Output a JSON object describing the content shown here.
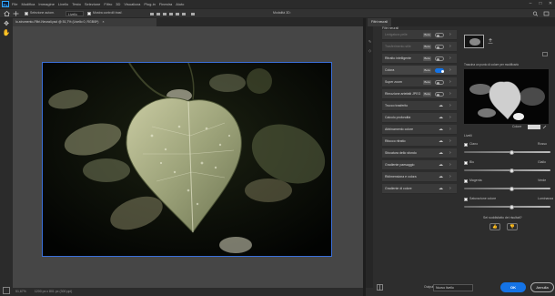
{
  "menubar": {
    "logo": "Ps",
    "items": [
      "File",
      "Modifica",
      "Immagine",
      "Livello",
      "Testo",
      "Selezione",
      "Filtro",
      "3D",
      "Visualizza",
      "Plug-in",
      "Finestra",
      "Aiuto"
    ]
  },
  "window_controls": {
    "minimize": "–",
    "maximize": "□",
    "close": "✕"
  },
  "options_bar": {
    "home_icon": "home-icon",
    "tool_icon": "move-tool-icon",
    "auto_select_label": "Selezione autom.",
    "layer_select": "Livello",
    "show_transform_label": "Mostra controlli trasf.",
    "mode_3d_label": "Modalità 3D:"
  },
  "document_tab": {
    "title": "lo-strumento-Filtri-Neurali.psd @ 51,7% (Livello 0, RGB/8*)",
    "close": "×"
  },
  "status_bar": {
    "zoom": "51,67%",
    "doc_info": "1200 px x 801 px (300 ppi)"
  },
  "panel": {
    "tab_title": "Filtri neurali",
    "featured_title": "Filtri neurali",
    "filters": [
      {
        "name": "Levigatura pelle",
        "badge": "Beta",
        "state": "off",
        "dim": true
      },
      {
        "name": "Trasferimento stile",
        "badge": "Beta",
        "state": "off",
        "dim": true
      },
      {
        "name": "Ritratto intelligente",
        "badge": "Beta",
        "state": "off",
        "dim": false
      },
      {
        "name": "Colora",
        "badge": "Beta",
        "state": "on",
        "dim": false
      },
      {
        "name": "Super zoom",
        "badge": "Beta",
        "state": "off",
        "dim": false
      },
      {
        "name": "Rimozione artefatti JPEG",
        "badge": "Beta",
        "state": "off",
        "dim": false
      },
      {
        "name": "Trucco trasferito",
        "badge": "",
        "state": "cloud",
        "dim": false
      },
      {
        "name": "Calcolo profondità",
        "badge": "",
        "state": "cloud",
        "dim": false
      },
      {
        "name": "Abbinamento colore",
        "badge": "",
        "state": "cloud",
        "dim": false
      },
      {
        "name": "Ritocco ritratto",
        "badge": "",
        "state": "cloud",
        "dim": false
      },
      {
        "name": "Sfocatura dello sfondo",
        "badge": "",
        "state": "cloud",
        "dim": false
      },
      {
        "name": "Gradiente paesaggio",
        "badge": "",
        "state": "cloud",
        "dim": false
      },
      {
        "name": "Ridimensiona e colora",
        "badge": "",
        "state": "cloud",
        "dim": false
      },
      {
        "name": "Gradiente di colore",
        "badge": "",
        "state": "cloud",
        "dim": false
      }
    ],
    "focus_point_label": "Trascina un punto di colore per modificarlo",
    "auto_color_label": "Colore",
    "section_label": "Livelli",
    "sliders": [
      {
        "label": "Ciano",
        "right": "Rosso",
        "value": 0.55
      },
      {
        "label": "Blu",
        "right": "Giallo",
        "value": 0.55
      },
      {
        "label": "Magenta",
        "right": "Verde",
        "value": 0.55
      },
      {
        "label": "Saturazione colore",
        "right": "Luminanza",
        "value": 0.55
      }
    ],
    "feedback_question": "Sei soddisfatto dei risultati?",
    "thumbs_up": "👍",
    "thumbs_down": "👎",
    "output_label": "Output",
    "output_value": "Nuovo livello",
    "ok_label": "OK",
    "cancel_label": "Annulla"
  }
}
